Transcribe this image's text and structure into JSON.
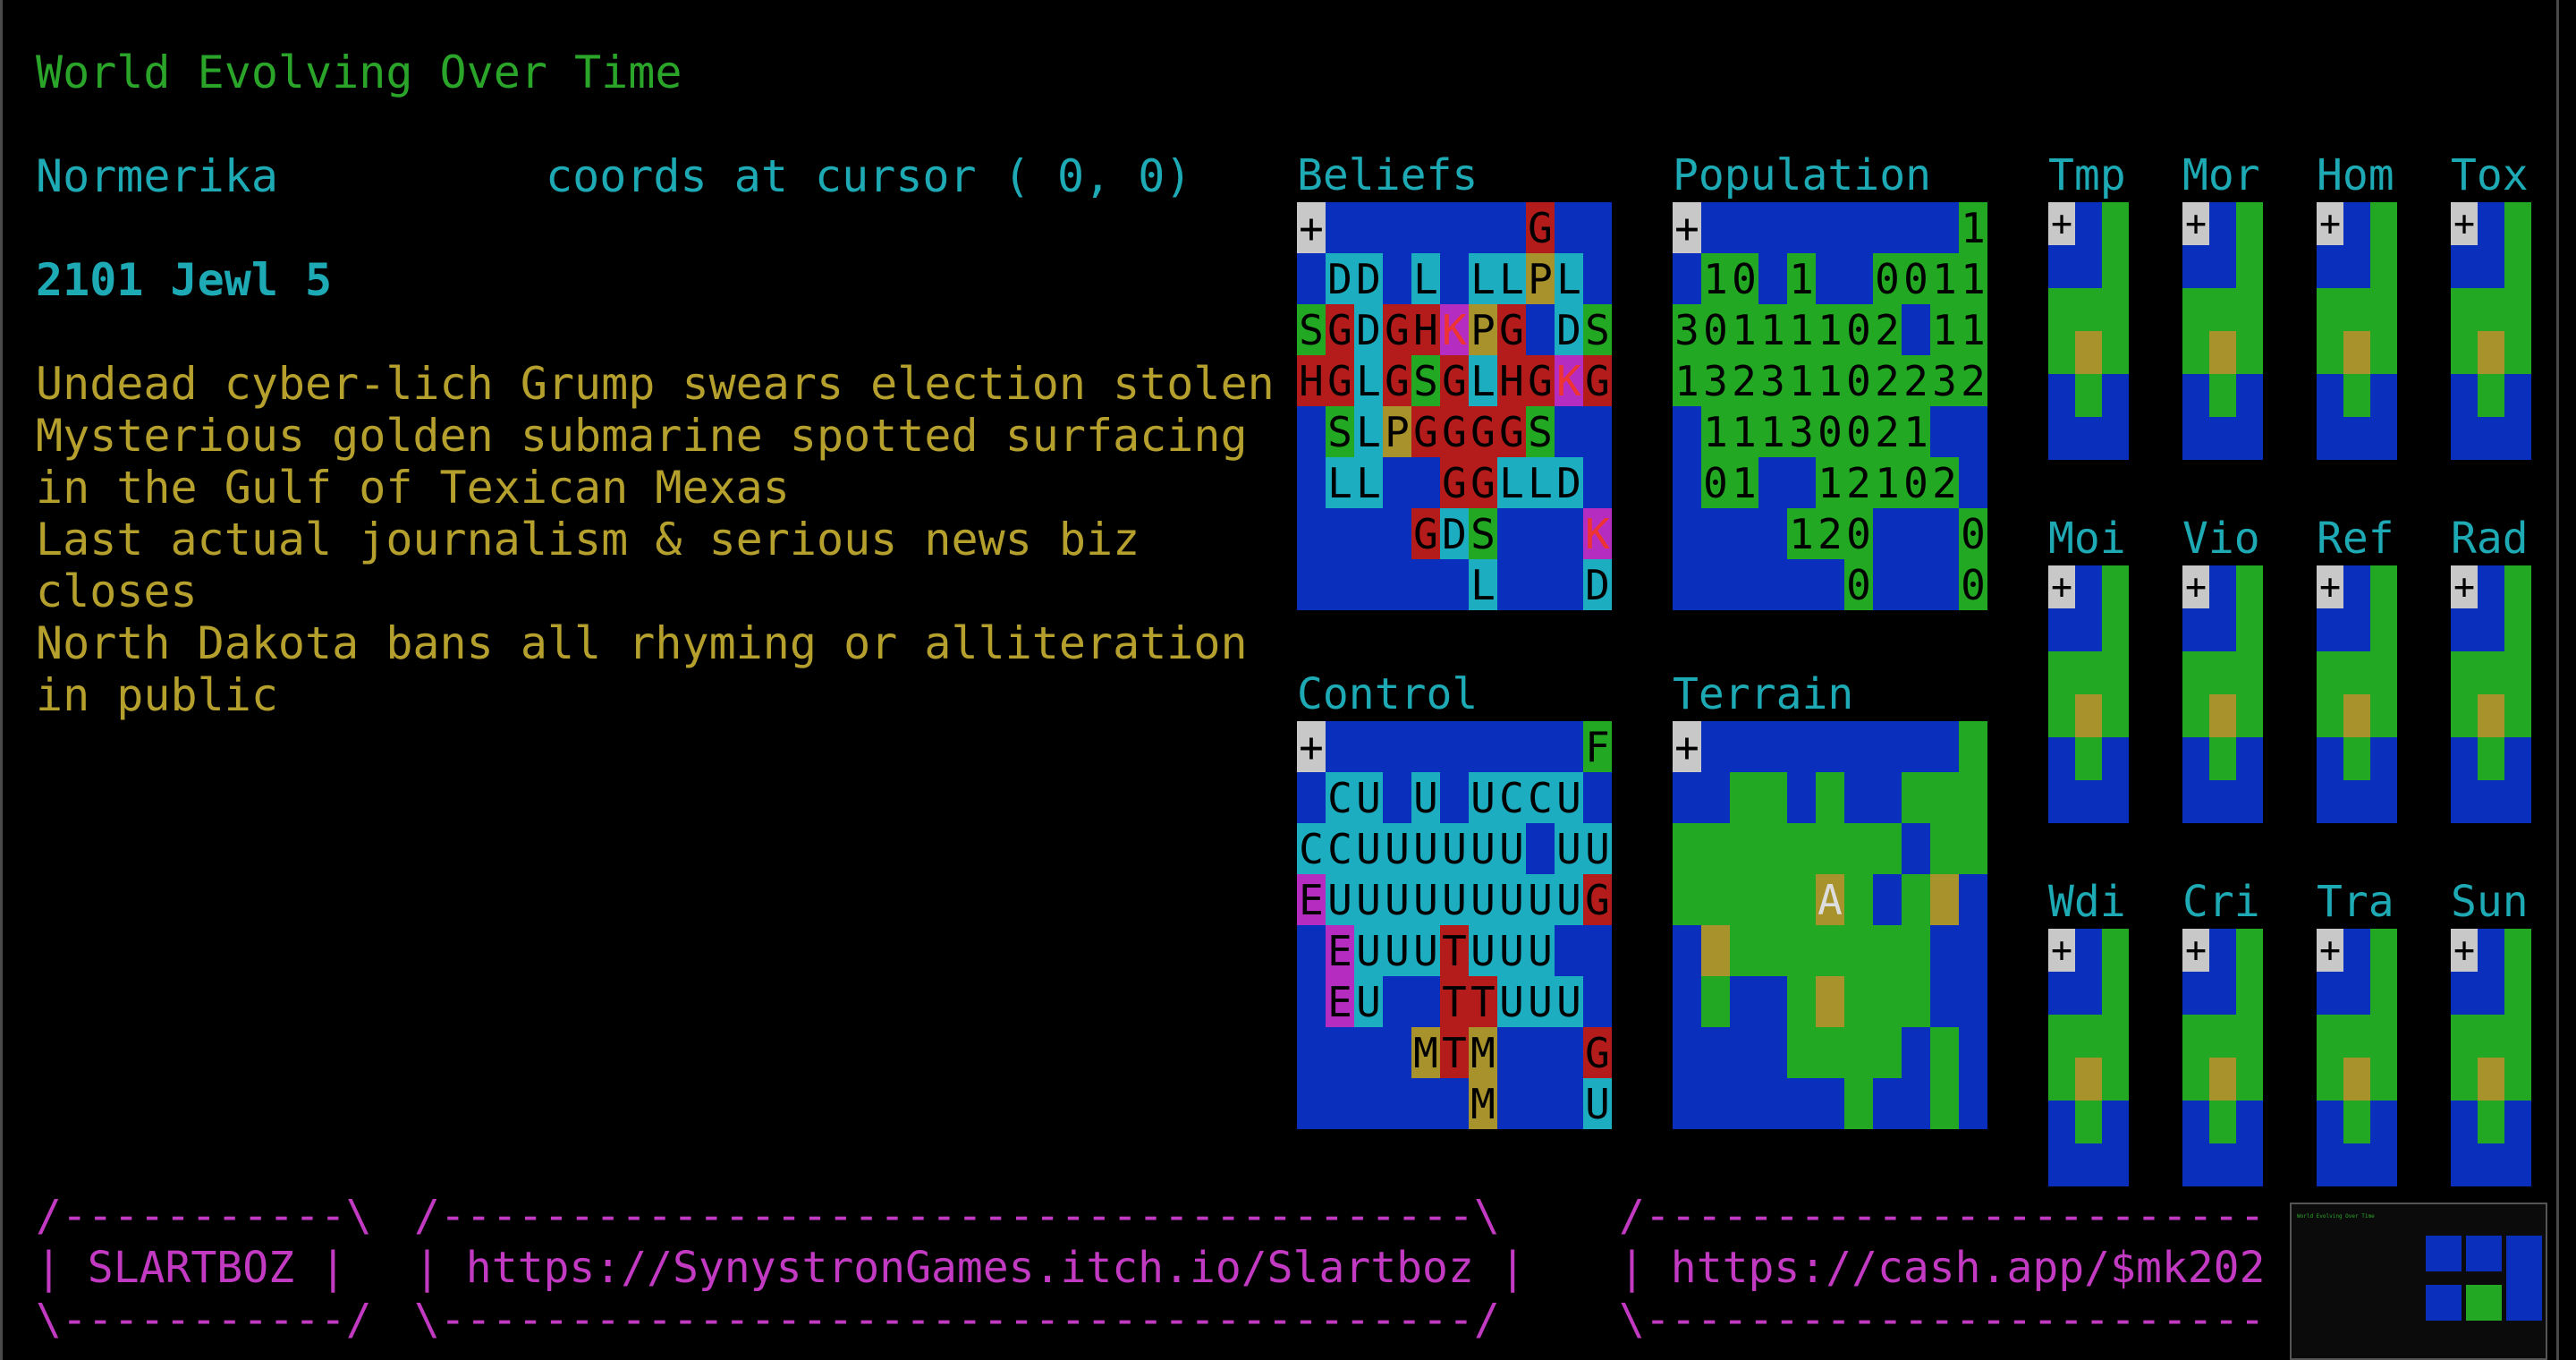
{
  "header": {
    "title": "World Evolving Over Time",
    "region": "Normerika",
    "cursor_label": "coords at cursor ( 0, 0)",
    "date": "2101 Jewl 5"
  },
  "news": [
    "Undead cyber-lich Grump swears election stolen",
    "Mysterious golden submarine spotted surfacing",
    "in the Gulf of Texican Mexas",
    "Last actual journalism & serious news biz",
    "closes",
    "North Dakota bans all rhyming or alliteration",
    "in public"
  ],
  "colors": {
    "blue": "#0b2fbd",
    "green": "#22a822",
    "cyan": "#1cadc1",
    "red": "#b41c1c",
    "magenta": "#b52cc0",
    "olive": "#a8922c",
    "gray": "#c8c8c8",
    "black": "#000000"
  },
  "panels": {
    "beliefs": {
      "title": "Beliefs",
      "rows": [
        "+.......G",
        ".DD.L.LLPL",
        "SGDGHKPG.DS",
        "HGLGSGLHGKG",
        ".SLPGGGGS..",
        ".LL..GGLLD.",
        "....GDS...K",
        "......L...D"
      ]
    },
    "population": {
      "title": "Population",
      "rows": [
        "+.........1",
        ".10.1..0011",
        "30111102.11",
        "13231102232",
        ".11130021..",
        ".01..12102.",
        "....120...0",
        "......0...0"
      ]
    },
    "control": {
      "title": "Control",
      "rows": [
        "+.........F",
        ".CU.U.UCCU",
        "CCUUUUUU.UU",
        "EUUUUUUUUUG",
        ".EUUUTUUU..",
        ".EU..TTUUU.",
        "....MTM...G",
        "......M...U"
      ]
    },
    "terrain": {
      "title": "Terrain",
      "marker": "A"
    }
  },
  "mini_maps": {
    "row1": [
      "Tmp",
      "Mor",
      "Hom",
      "Tox"
    ],
    "row2": [
      "Moi",
      "Vio",
      "Ref",
      "Rad"
    ],
    "row3": [
      "Wdi",
      "Cri",
      "Tra",
      "Sun"
    ]
  },
  "banners": {
    "name": "SLARTBOZ",
    "link1": "https://SynystronGames.itch.io/Slartboz",
    "link2": "https://cash.app/$mk202"
  },
  "plus_glyph": "+"
}
